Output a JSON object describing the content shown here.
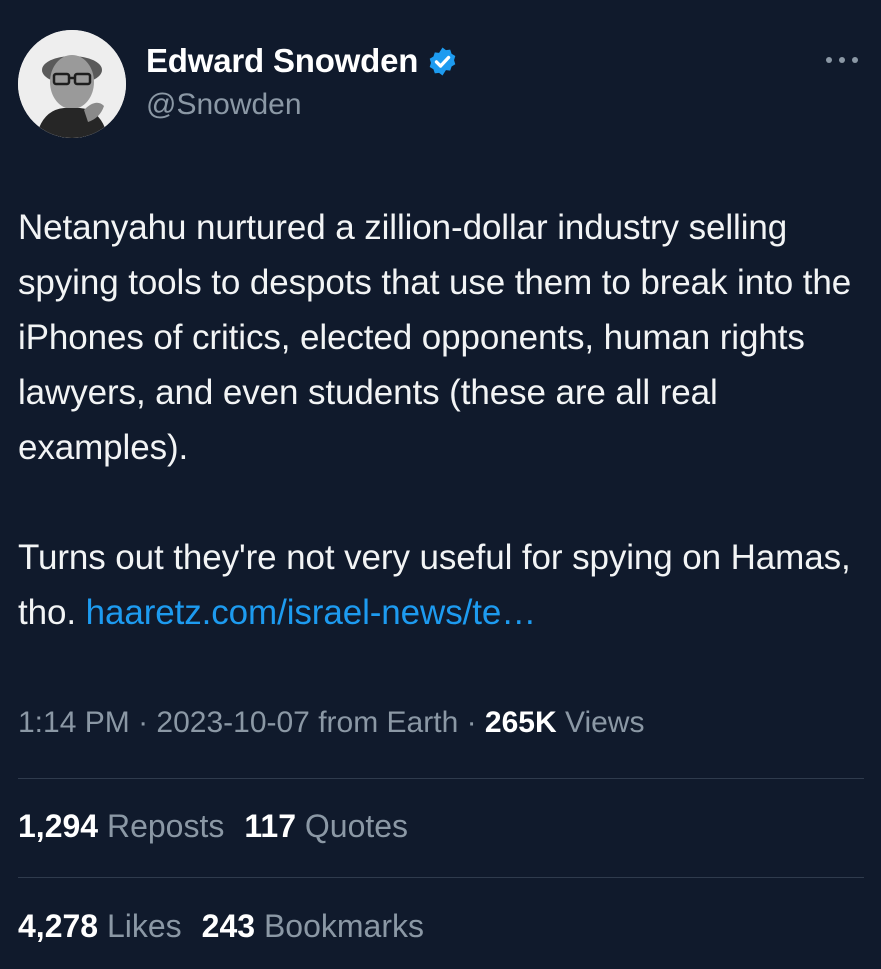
{
  "author": {
    "name": "Edward Snowden",
    "handle": "@Snowden"
  },
  "tweet": {
    "text_1": "Netanyahu nurtured a zillion-dollar industry selling spying tools to despots that use them to break into the iPhones of critics, elected opponents, human rights lawyers, and even students (these are all real examples).",
    "text_2": "Turns out they're not very useful for spying on Hamas, tho.",
    "link": "haaretz.com/israel-news/te…"
  },
  "meta": {
    "time": "1:14 PM",
    "sep1": " · ",
    "date": "2023-10-07",
    "source": " from Earth",
    "sep2": " · ",
    "views_count": "265K",
    "views_label": " Views"
  },
  "stats": {
    "reposts_count": "1,294",
    "reposts_label": " Reposts",
    "quotes_count": "117",
    "quotes_label": " Quotes",
    "likes_count": "4,278",
    "likes_label": " Likes",
    "bookmarks_count": "243",
    "bookmarks_label": " Bookmarks"
  },
  "icons": {
    "verified": "verified-badge-icon",
    "more": "more-options-icon"
  },
  "colors": {
    "background": "#101a2c",
    "link": "#1d9bf0",
    "muted": "#8b98a5",
    "verified": "#1d9bf0"
  }
}
